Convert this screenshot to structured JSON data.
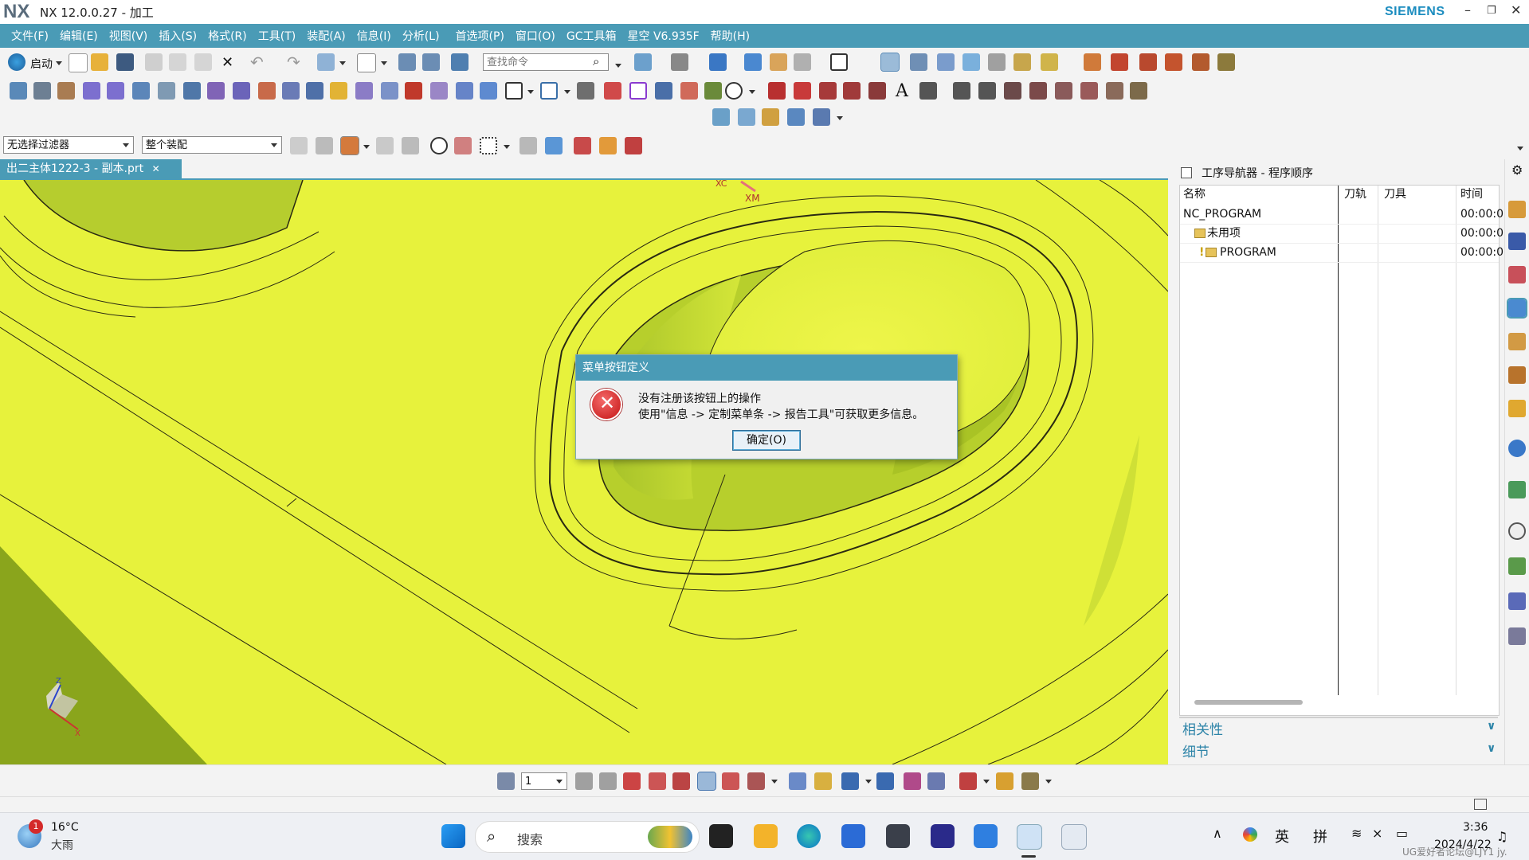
{
  "window": {
    "logo": "NX",
    "title": "NX 12.0.0.27 - 加工",
    "brand": "SIEMENS",
    "controls": [
      "–",
      "❐",
      "✕"
    ]
  },
  "menu": [
    "文件(F)",
    "编辑(E)",
    "视图(V)",
    "插入(S)",
    "格式(R)",
    "工具(T)",
    "装配(A)",
    "信息(I)",
    "分析(L)",
    "首选项(P)",
    "窗口(O)",
    "GC工具箱",
    "星空 V6.935F",
    "帮助(H)"
  ],
  "toolbar": {
    "start_label": "启动",
    "command_search_placeholder": "查找命令",
    "selection_filter": "无选择过滤器",
    "assembly_scope": "整个装配",
    "layer_value": "1"
  },
  "document": {
    "tab_label": "出二主体1222-3 - 副本.prt",
    "close_glyph": "✕"
  },
  "viewport": {
    "axis_labels": [
      "XC",
      "XM"
    ],
    "triad_labels": [
      "Z",
      "X"
    ],
    "colors": {
      "surface": "#e7f23c",
      "dark_surface": "#8aa51c",
      "edge": "#2a2a12"
    }
  },
  "dialog": {
    "title": "菜单按钮定义",
    "message_line1": "没有注册该按钮上的操作",
    "message_line2": "使用\"信息 -> 定制菜单条 -> 报告工具\"可获取更多信息。",
    "ok_label": "确定(O)",
    "icon": "error-icon"
  },
  "navigator": {
    "title": "工序导航器 - 程序顺序",
    "columns": [
      "名称",
      "刀轨",
      "刀具",
      "时间"
    ],
    "rows": [
      {
        "name": "NC_PROGRAM",
        "time": "00:00:0"
      },
      {
        "name": "未用项",
        "time": "00:00:0"
      },
      {
        "name": "PROGRAM",
        "time": "00:00:0"
      }
    ],
    "sections": [
      "相关性",
      "细节"
    ]
  },
  "taskbar": {
    "weather_temp": "16°C",
    "weather_desc": "大雨",
    "weather_badge": "1",
    "search_placeholder": "搜索",
    "ime_lang": "英",
    "ime_mode": "拼",
    "time": "3:36",
    "date": "2024/4/22",
    "watermark": "UG爱好者论坛@LJY1 jy."
  },
  "accent_color": "#4a9bb6"
}
